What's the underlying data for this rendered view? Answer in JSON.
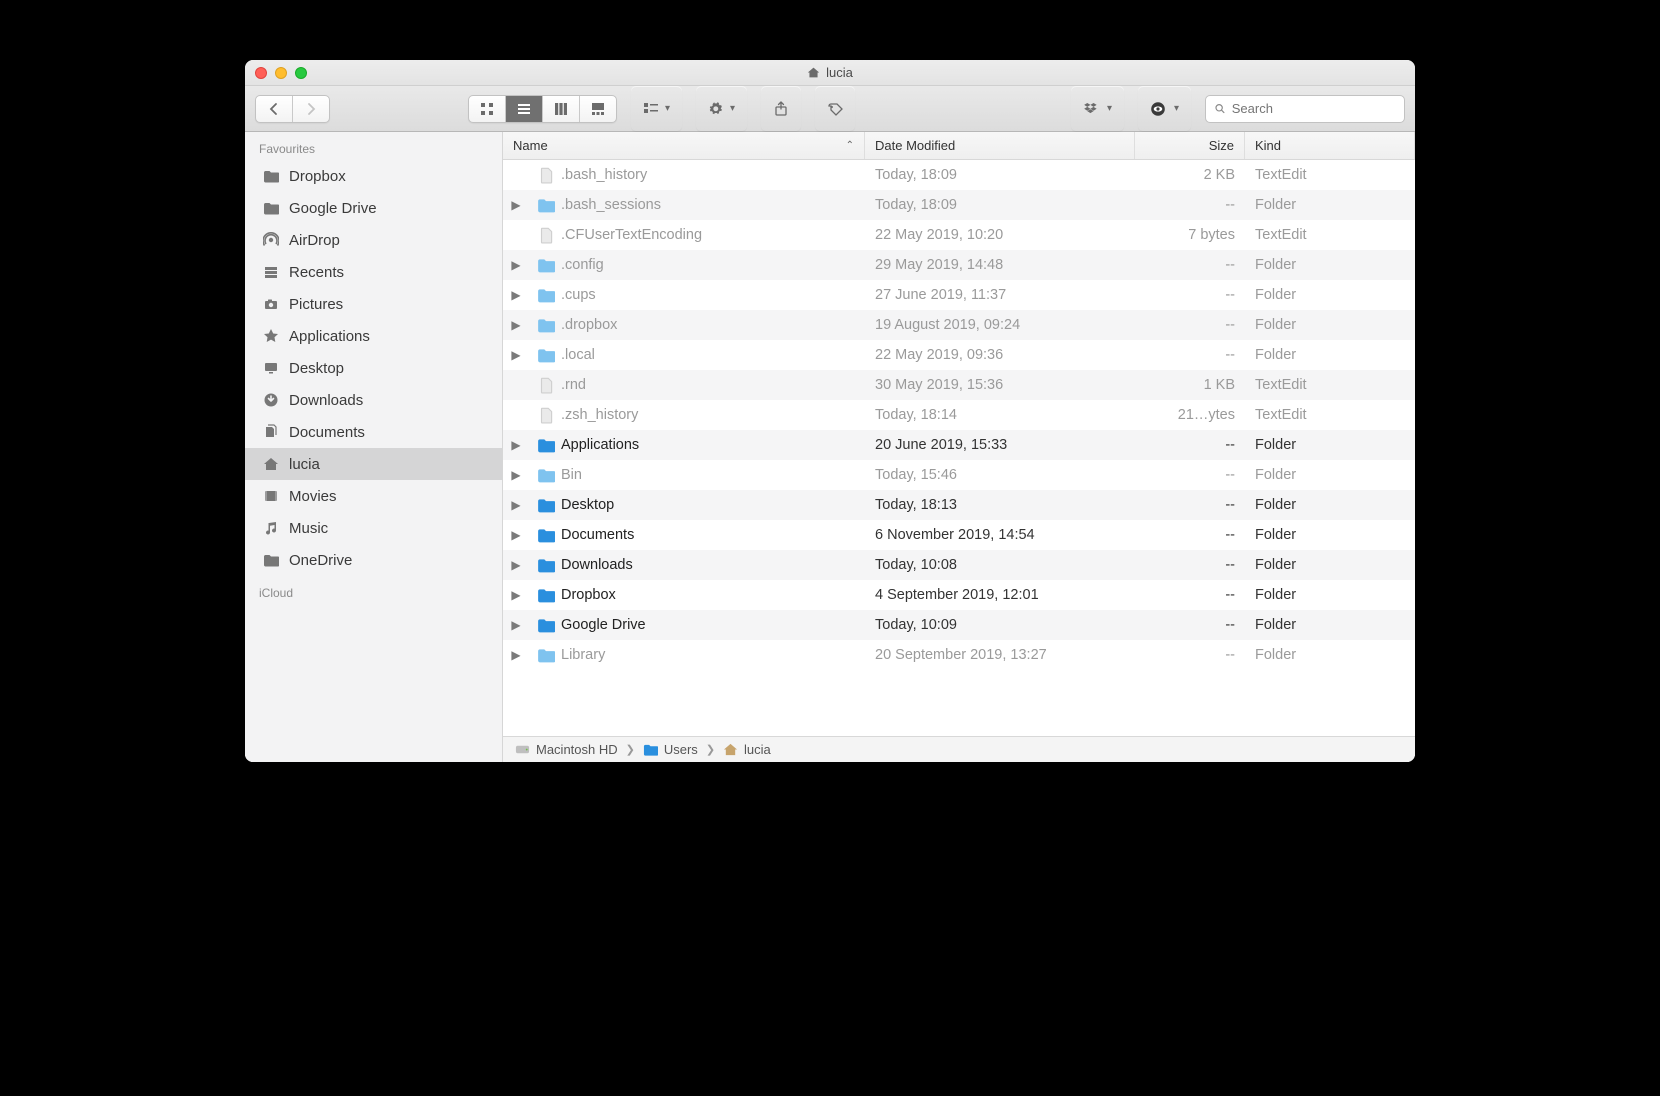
{
  "window": {
    "title": "lucia"
  },
  "toolbar": {
    "search_placeholder": "Search"
  },
  "sidebar": {
    "sections": [
      {
        "heading": "Favourites",
        "items": [
          {
            "label": "Dropbox",
            "icon": "folder"
          },
          {
            "label": "Google Drive",
            "icon": "folder"
          },
          {
            "label": "AirDrop",
            "icon": "airdrop"
          },
          {
            "label": "Recents",
            "icon": "recents"
          },
          {
            "label": "Pictures",
            "icon": "camera"
          },
          {
            "label": "Applications",
            "icon": "apps"
          },
          {
            "label": "Desktop",
            "icon": "desktop"
          },
          {
            "label": "Downloads",
            "icon": "downloads"
          },
          {
            "label": "Documents",
            "icon": "documents"
          },
          {
            "label": "lucia",
            "icon": "home",
            "selected": true
          },
          {
            "label": "Movies",
            "icon": "movies"
          },
          {
            "label": "Music",
            "icon": "music"
          },
          {
            "label": "OneDrive",
            "icon": "folder"
          }
        ]
      },
      {
        "heading": "iCloud",
        "items": []
      }
    ]
  },
  "columns": {
    "name": "Name",
    "date": "Date Modified",
    "size": "Size",
    "kind": "Kind"
  },
  "files": [
    {
      "name": ".bash_history",
      "date": "Today, 18:09",
      "size": "2 KB",
      "kind": "TextEdit",
      "type": "file",
      "dim": true,
      "expandable": false
    },
    {
      "name": ".bash_sessions",
      "date": "Today, 18:09",
      "size": "--",
      "kind": "Folder",
      "type": "folder",
      "dim": true,
      "expandable": true
    },
    {
      "name": ".CFUserTextEncoding",
      "date": "22 May 2019, 10:20",
      "size": "7 bytes",
      "kind": "TextEdit",
      "type": "file",
      "dim": true,
      "expandable": false
    },
    {
      "name": ".config",
      "date": "29 May 2019, 14:48",
      "size": "--",
      "kind": "Folder",
      "type": "folder",
      "dim": true,
      "expandable": true
    },
    {
      "name": ".cups",
      "date": "27 June 2019, 11:37",
      "size": "--",
      "kind": "Folder",
      "type": "folder",
      "dim": true,
      "expandable": true
    },
    {
      "name": ".dropbox",
      "date": "19 August 2019, 09:24",
      "size": "--",
      "kind": "Folder",
      "type": "folder",
      "dim": true,
      "expandable": true
    },
    {
      "name": ".local",
      "date": "22 May 2019, 09:36",
      "size": "--",
      "kind": "Folder",
      "type": "folder",
      "dim": true,
      "expandable": true
    },
    {
      "name": ".rnd",
      "date": "30 May 2019, 15:36",
      "size": "1 KB",
      "kind": "TextEdit",
      "type": "file",
      "dim": true,
      "expandable": false
    },
    {
      "name": ".zsh_history",
      "date": "Today, 18:14",
      "size": "21…ytes",
      "kind": "TextEdit",
      "type": "file",
      "dim": true,
      "expandable": false
    },
    {
      "name": "Applications",
      "date": "20 June 2019, 15:33",
      "size": "--",
      "kind": "Folder",
      "type": "folder-strong",
      "dim": false,
      "expandable": true
    },
    {
      "name": "Bin",
      "date": "Today, 15:46",
      "size": "--",
      "kind": "Folder",
      "type": "folder",
      "dim": true,
      "expandable": true
    },
    {
      "name": "Desktop",
      "date": "Today, 18:13",
      "size": "--",
      "kind": "Folder",
      "type": "folder-strong",
      "dim": false,
      "expandable": true
    },
    {
      "name": "Documents",
      "date": "6 November 2019, 14:54",
      "size": "--",
      "kind": "Folder",
      "type": "folder-strong",
      "dim": false,
      "expandable": true
    },
    {
      "name": "Downloads",
      "date": "Today, 10:08",
      "size": "--",
      "kind": "Folder",
      "type": "folder-strong",
      "dim": false,
      "expandable": true
    },
    {
      "name": "Dropbox",
      "date": "4 September 2019, 12:01",
      "size": "--",
      "kind": "Folder",
      "type": "folder-strong",
      "dim": false,
      "expandable": true
    },
    {
      "name": "Google Drive",
      "date": "Today, 10:09",
      "size": "--",
      "kind": "Folder",
      "type": "folder-strong",
      "dim": false,
      "expandable": true
    },
    {
      "name": "Library",
      "date": "20 September 2019, 13:27",
      "size": "--",
      "kind": "Folder",
      "type": "folder",
      "dim": true,
      "expandable": true
    }
  ],
  "path": [
    {
      "label": "Macintosh HD",
      "icon": "disk"
    },
    {
      "label": "Users",
      "icon": "folder-strong"
    },
    {
      "label": "lucia",
      "icon": "home"
    }
  ]
}
